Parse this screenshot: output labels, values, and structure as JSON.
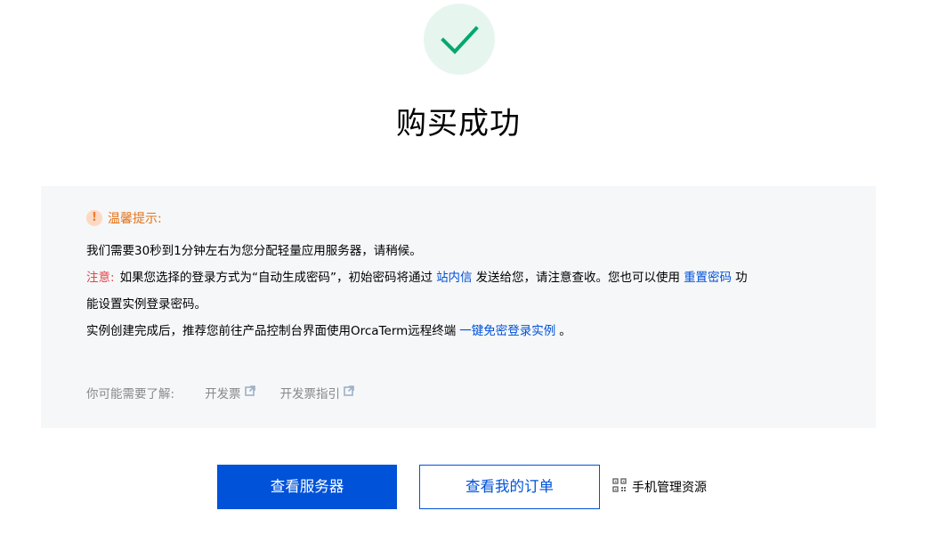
{
  "status": {
    "icon": "check-circle-icon",
    "title": "购买成功"
  },
  "notice": {
    "icon": "warning-circle-icon",
    "title": "温馨提示:",
    "line1": "我们需要30秒到1分钟左右为您分配轻量应用服务器，请稍候。",
    "line2": {
      "prefix": "注意:",
      "text_before_link1": "如果您选择的登录方式为“自动生成密码”，初始密码将通过",
      "link1": "站内信",
      "text_between": "发送给您，请注意查收。您也可以使用",
      "link2": "重置密码",
      "text_after": "功"
    },
    "line3": "能设置实例登录密码。",
    "line4": {
      "text": "实例创建完成后，推荐您前往产品控制台界面使用OrcaTerm远程终端",
      "link": "一键免密登录实例",
      "text_after": "。"
    }
  },
  "related": {
    "label": "你可能需要了解:",
    "links": [
      {
        "label": "开发票",
        "icon": "external-link-icon"
      },
      {
        "label": "开发票指引",
        "icon": "external-link-icon"
      }
    ]
  },
  "actions": {
    "primary": "查看服务器",
    "secondary": "查看我的订单",
    "mobile": {
      "icon": "qr-code-icon",
      "label": "手机管理资源"
    }
  },
  "colors": {
    "success": "#00a870",
    "success_bg": "#e6f6ef",
    "warning": "#e37318",
    "warning_bg": "#fdd9c3",
    "danger": "#e54545",
    "link": "#0052d9",
    "panel_bg": "#f6f7f9",
    "muted": "#888888"
  }
}
